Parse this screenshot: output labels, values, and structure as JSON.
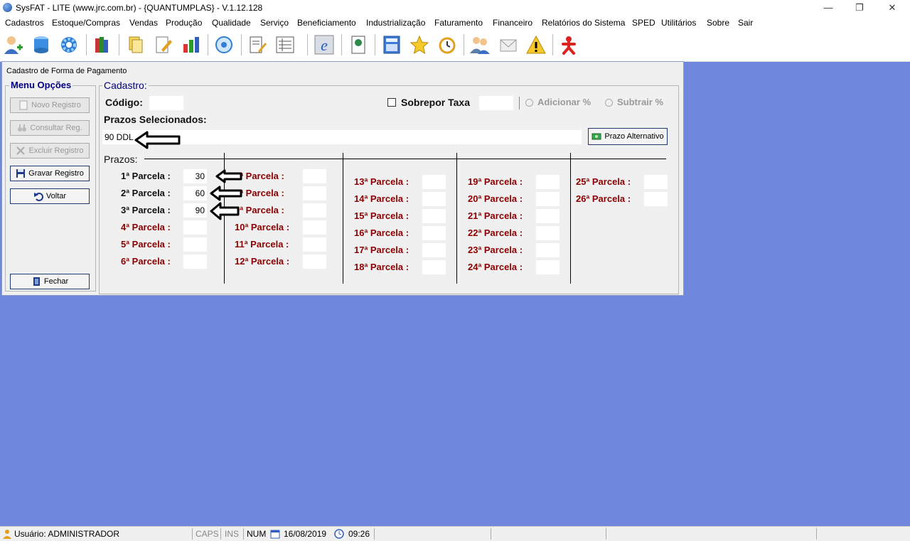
{
  "window": {
    "title": "SysFAT - LITE (www.jrc.com.br) - {QUANTUMPLAS} - V.1.12.128"
  },
  "menu": [
    "Cadastros",
    "Estoque/Compras",
    "Vendas",
    "Produção",
    "Qualidade",
    "Serviço",
    "Beneficiamento",
    "Industrialização",
    "Faturamento",
    "Financeiro",
    "Relatórios do Sistema",
    "SPED",
    "Utilitários",
    "Sobre",
    "Sair"
  ],
  "toolbar_icons": [
    "user-add-icon",
    "database-icon",
    "gear-icon",
    "books-icon",
    "documents-icon",
    "edit-document-icon",
    "bar-chart-icon",
    "settings-disc-icon",
    "notepad-icon",
    "list-icon",
    "internet-explorer-icon",
    "document-view-icon",
    "calculator-icon",
    "star-icon",
    "alarm-clock-icon",
    "users-icon",
    "mail-icon",
    "warning-icon",
    "exit-person-icon"
  ],
  "form": {
    "title": "Cadastro de Forma de Pagamento",
    "menu_group": "Menu Opções",
    "buttons": {
      "novo": "Novo Registro",
      "consultar": "Consultar Reg.",
      "excluir": "Excluir Registro",
      "gravar": "Gravar Registro",
      "voltar": "Voltar",
      "fechar": "Fechar"
    },
    "cadastro_group": "Cadastro:",
    "codigo_label": "Código:",
    "codigo_value": "",
    "sobrepor_label": "Sobrepor Taxa",
    "adicionar_label": "Adicionar %",
    "subtrair_label": "Subtrair %",
    "prazos_selecionados_label": "Prazos Selecionados:",
    "prazos_selecionados_value": "90 DDL",
    "prazo_alternativo": "Prazo Alternativo",
    "prazos_label": "Prazos:",
    "parcelas": [
      {
        "label": "1ª Parcela :",
        "value": "30"
      },
      {
        "label": "2ª Parcela :",
        "value": "60"
      },
      {
        "label": "3ª Parcela :",
        "value": "90"
      },
      {
        "label": "4ª Parcela :",
        "value": ""
      },
      {
        "label": "5ª Parcela :",
        "value": ""
      },
      {
        "label": "6ª Parcela :",
        "value": ""
      },
      {
        "label": "7ª Parcela :",
        "value": ""
      },
      {
        "label": "8ª Parcela :",
        "value": ""
      },
      {
        "label": "9ª Parcela :",
        "value": ""
      },
      {
        "label": "10ª Parcela :",
        "value": ""
      },
      {
        "label": "11ª Parcela :",
        "value": ""
      },
      {
        "label": "12ª Parcela :",
        "value": ""
      },
      {
        "label": "13ª Parcela :",
        "value": ""
      },
      {
        "label": "14ª Parcela :",
        "value": ""
      },
      {
        "label": "15ª Parcela :",
        "value": ""
      },
      {
        "label": "16ª Parcela :",
        "value": ""
      },
      {
        "label": "17ª Parcela :",
        "value": ""
      },
      {
        "label": "18ª Parcela :",
        "value": ""
      },
      {
        "label": "19ª Parcela :",
        "value": ""
      },
      {
        "label": "20ª Parcela :",
        "value": ""
      },
      {
        "label": "21ª Parcela :",
        "value": ""
      },
      {
        "label": "22ª Parcela :",
        "value": ""
      },
      {
        "label": "23ª Parcela :",
        "value": ""
      },
      {
        "label": "24ª Parcela :",
        "value": ""
      },
      {
        "label": "25ª Parcela :",
        "value": ""
      },
      {
        "label": "26ª Parcela :",
        "value": ""
      }
    ]
  },
  "status": {
    "user": "Usuário: ADMINISTRADOR",
    "caps": "CAPS",
    "ins": "INS",
    "num": "NUM",
    "date": "16/08/2019",
    "time": "09:26"
  },
  "colors": {
    "desktop": "#6f88dc",
    "parcela_red": "#8b0000",
    "legend_blue": "#000080"
  }
}
